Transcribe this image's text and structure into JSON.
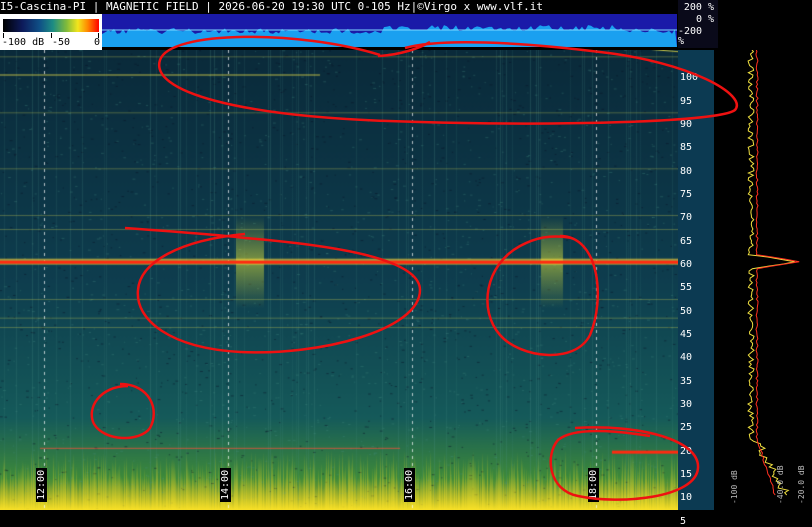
{
  "header": {
    "title": "I5-Cascina-PI | MAGNETIC FIELD | 2026-06-20 19:30 UTC 0-105 Hz|©Virgo x www.vlf.it"
  },
  "colorbar": {
    "labels": [
      "-100 dB",
      "-50",
      "0"
    ]
  },
  "amplitude_axis": {
    "labels": [
      "200 %",
      "0 %",
      "-200 %"
    ]
  },
  "profile_axis": {
    "labels": [
      "-100 dB",
      "-40.0 dB",
      "-20.0 dB"
    ]
  },
  "colors": {
    "line_50hz": "#ff2a10",
    "annotation": "#ee1111",
    "amplitude_fill": "#1aa0f0",
    "axis_bg": "#0c3a52"
  },
  "chart_data": {
    "type": "heatmap",
    "title": "I5-Cascina-PI | MAGNETIC FIELD | 2026-06-20 19:30 UTC 0-105 Hz|©Virgo x www.vlf.it",
    "xlabel": "",
    "ylabel": "",
    "ylim": [
      0,
      105
    ],
    "x_ticks": [
      "12:00",
      "14:00",
      "16:00",
      "18:00"
    ],
    "y_ticks": [
      5,
      10,
      15,
      20,
      25,
      30,
      35,
      40,
      45,
      50,
      55,
      60,
      65,
      70,
      75,
      80,
      85,
      90,
      95,
      100
    ],
    "colorbar": {
      "min_db": -100,
      "max_db": 0
    },
    "spectral_lines_hz": [
      50,
      100
    ],
    "profile_peaks_hz": [
      50,
      100
    ]
  }
}
